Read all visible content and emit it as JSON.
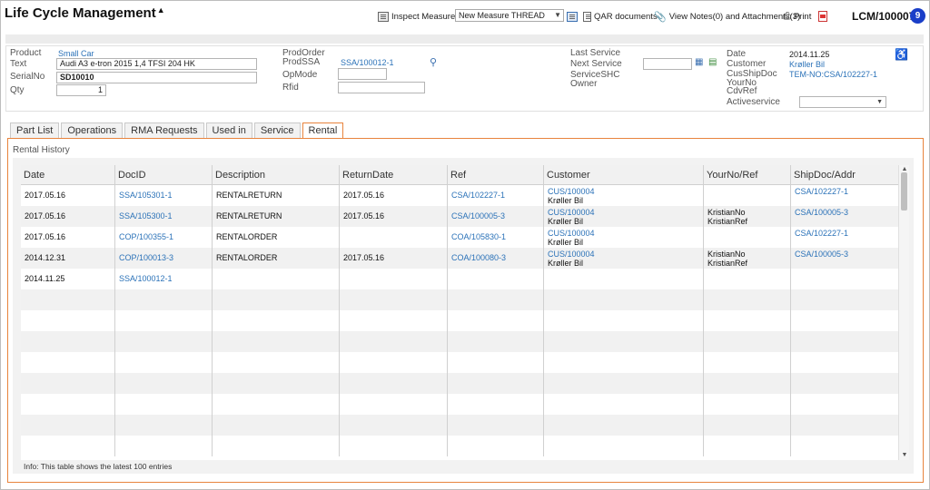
{
  "app": {
    "title": "Life Cycle Management",
    "record_id": "LCM/100007",
    "badge_count": "9"
  },
  "toolbar": {
    "inspect_measures": "Inspect Measures",
    "measure_select": "New Measure THREAD",
    "qar_documents": "QAR documents",
    "view_notes": "View Notes(0) and Attachments(3)",
    "print": "Print"
  },
  "info": {
    "product_label": "Product",
    "product_value": "Small Car",
    "text_label": "Text",
    "text_value": "Audi A3 e-tron 2015 1,4 TFSI 204 HK",
    "serial_label": "SerialNo",
    "serial_value": "SD10010",
    "qty_label": "Qty",
    "qty_value": "1",
    "prodorder_label": "ProdOrder",
    "prodssa_label": "ProdSSA",
    "prodssa_value": "SSA/100012-1",
    "opmode_label": "OpMode",
    "rfid_label": "Rfid",
    "last_service_label": "Last Service",
    "next_service_label": "Next Service",
    "service_shc_label": "ServiceSHC",
    "owner_label": "Owner",
    "date_label": "Date",
    "date_value": "2014.11.25",
    "customer_label": "Customer",
    "customer_value": "Krøller Bil",
    "cusshipdoc_label": "CusShipDoc",
    "cusshipdoc_value": "TEM-NO:CSA/102227-1",
    "yourno_label": "YourNo",
    "cdvref_label": "CdvRef",
    "activeservice_label": "Activeservice"
  },
  "tabs": [
    "Part List",
    "Operations",
    "RMA Requests",
    "Used in",
    "Service",
    "Rental"
  ],
  "active_tab": "Rental",
  "rental": {
    "section_title": "Rental History",
    "columns": [
      "Date",
      "DocID",
      "Description",
      "ReturnDate",
      "Ref",
      "Customer",
      "YourNo/Ref",
      "ShipDoc/Addr"
    ],
    "rows": [
      {
        "date": "2017.05.16",
        "docid": "SSA/105301-1",
        "description": "RENTALRETURN",
        "returndate": "2017.05.16",
        "ref": "CSA/102227-1",
        "customer_id": "CUS/100004",
        "customer_name": "Krøller Bil",
        "yourno": "",
        "yourref": "",
        "shipdoc": "CSA/102227-1"
      },
      {
        "date": "2017.05.16",
        "docid": "SSA/105300-1",
        "description": "RENTALRETURN",
        "returndate": "2017.05.16",
        "ref": "CSA/100005-3",
        "customer_id": "CUS/100004",
        "customer_name": "Krøller Bil",
        "yourno": "KristianNo",
        "yourref": "KristianRef",
        "shipdoc": "CSA/100005-3"
      },
      {
        "date": "2017.05.16",
        "docid": "COP/100355-1",
        "description": "RENTALORDER",
        "returndate": "",
        "ref": "COA/105830-1",
        "customer_id": "CUS/100004",
        "customer_name": "Krøller Bil",
        "yourno": "",
        "yourref": "",
        "shipdoc": "CSA/102227-1"
      },
      {
        "date": "2014.12.31",
        "docid": "COP/100013-3",
        "description": "RENTALORDER",
        "returndate": "2017.05.16",
        "ref": "COA/100080-3",
        "customer_id": "CUS/100004",
        "customer_name": "Krøller Bil",
        "yourno": "KristianNo",
        "yourref": "KristianRef",
        "shipdoc": "CSA/100005-3"
      },
      {
        "date": "2014.11.25",
        "docid": "SSA/100012-1",
        "description": "",
        "returndate": "",
        "ref": "",
        "customer_id": "",
        "customer_name": "",
        "yourno": "",
        "yourref": "",
        "shipdoc": ""
      }
    ],
    "footer_info": "Info: This table shows the latest 100 entries"
  }
}
